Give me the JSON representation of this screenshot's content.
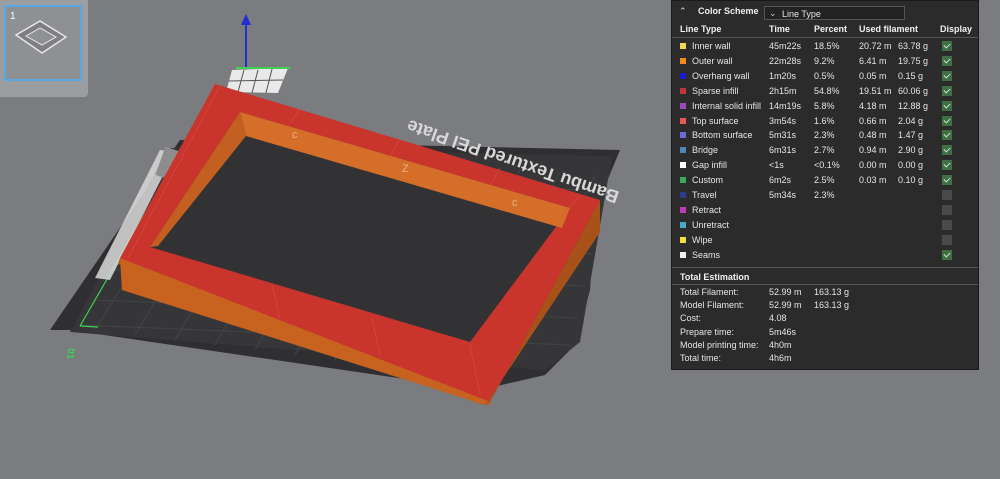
{
  "thumbnail": {
    "plate_number": "1"
  },
  "plate": {
    "label": "Bambu Textured PEI Plate",
    "side_number": "01"
  },
  "panel": {
    "title": "Color Scheme",
    "scheme_value": "Line Type",
    "columns": {
      "line_type": "Line Type",
      "time": "Time",
      "percent": "Percent",
      "used": "Used filament",
      "display": "Display"
    },
    "rows": [
      {
        "name": "Inner wall",
        "color": "#f2d55a",
        "time": "45m22s",
        "percent": "18.5%",
        "len": "20.72 m",
        "weight": "63.78 g",
        "display": true
      },
      {
        "name": "Outer wall",
        "color": "#f08a1e",
        "time": "22m28s",
        "percent": "9.2%",
        "len": "6.41 m",
        "weight": "19.75 g",
        "display": true
      },
      {
        "name": "Overhang wall",
        "color": "#1c1ccf",
        "time": "1m20s",
        "percent": "0.5%",
        "len": "0.05 m",
        "weight": "0.15 g",
        "display": true
      },
      {
        "name": "Sparse infill",
        "color": "#c0343a",
        "time": "2h15m",
        "percent": "54.8%",
        "len": "19.51 m",
        "weight": "60.06 g",
        "display": true
      },
      {
        "name": "Internal solid infill",
        "color": "#9a4ab8",
        "time": "14m19s",
        "percent": "5.8%",
        "len": "4.18 m",
        "weight": "12.88 g",
        "display": true
      },
      {
        "name": "Top surface",
        "color": "#e45858",
        "time": "3m54s",
        "percent": "1.6%",
        "len": "0.66 m",
        "weight": "2.04 g",
        "display": true
      },
      {
        "name": "Bottom surface",
        "color": "#6a6ad8",
        "time": "5m31s",
        "percent": "2.3%",
        "len": "0.48 m",
        "weight": "1.47 g",
        "display": true
      },
      {
        "name": "Bridge",
        "color": "#4f86b8",
        "time": "6m31s",
        "percent": "2.7%",
        "len": "0.94 m",
        "weight": "2.90 g",
        "display": true
      },
      {
        "name": "Gap infill",
        "color": "#ffffff",
        "time": "<1s",
        "percent": "<0.1%",
        "len": "0.00 m",
        "weight": "0.00 g",
        "display": true
      },
      {
        "name": "Custom",
        "color": "#3ea85a",
        "time": "6m2s",
        "percent": "2.5%",
        "len": "0.03 m",
        "weight": "0.10 g",
        "display": true
      },
      {
        "name": "Travel",
        "color": "#2e3a8c",
        "time": "5m34s",
        "percent": "2.3%",
        "len": "",
        "weight": "",
        "display": false
      },
      {
        "name": "Retract",
        "color": "#c03ab8",
        "time": "",
        "percent": "",
        "len": "",
        "weight": "",
        "display": false
      },
      {
        "name": "Unretract",
        "color": "#4aa8c8",
        "time": "",
        "percent": "",
        "len": "",
        "weight": "",
        "display": false
      },
      {
        "name": "Wipe",
        "color": "#f2e23a",
        "time": "",
        "percent": "",
        "len": "",
        "weight": "",
        "display": false
      },
      {
        "name": "Seams",
        "color": "#f0f0f0",
        "time": "",
        "percent": "",
        "len": "",
        "weight": "",
        "display": true
      }
    ],
    "total_title": "Total Estimation",
    "totals": [
      {
        "label": "Total Filament:",
        "v1": "52.99 m",
        "v2": "163.13 g"
      },
      {
        "label": "Model Filament:",
        "v1": "52.99 m",
        "v2": "163.13 g"
      },
      {
        "label": "Cost:",
        "v1": "4.08",
        "v2": ""
      },
      {
        "label": "Prepare time:",
        "v1": "5m46s",
        "v2": ""
      },
      {
        "label": "Model printing time:",
        "v1": "4h0m",
        "v2": ""
      },
      {
        "label": "Total time:",
        "v1": "4h6m",
        "v2": ""
      }
    ]
  }
}
